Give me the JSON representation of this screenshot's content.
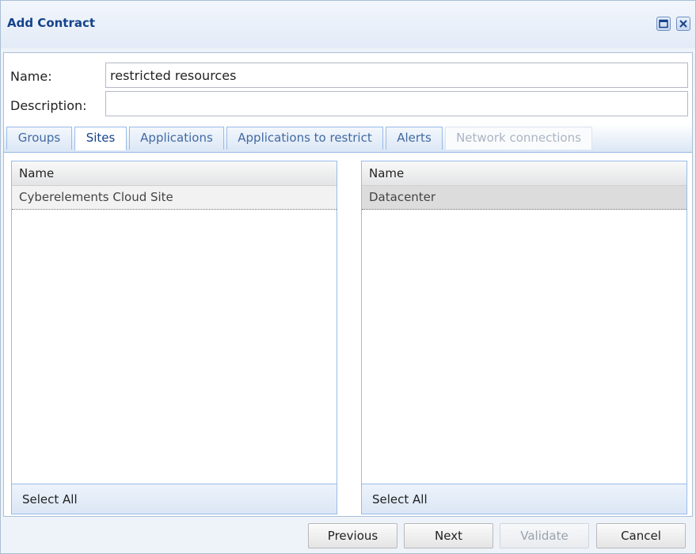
{
  "window": {
    "title": "Add Contract"
  },
  "form": {
    "name_label": "Name:",
    "name_value": "restricted resources",
    "description_label": "Description:",
    "description_value": ""
  },
  "tabs": [
    {
      "label": "Groups"
    },
    {
      "label": "Sites",
      "active": true
    },
    {
      "label": "Applications"
    },
    {
      "label": "Applications to restrict"
    },
    {
      "label": "Alerts"
    },
    {
      "label": "Network connections",
      "disabled": true
    }
  ],
  "left_grid": {
    "header": "Name",
    "rows": [
      "Cyberelements Cloud Site"
    ],
    "footer": "Select All"
  },
  "right_grid": {
    "header": "Name",
    "rows": [
      "Datacenter"
    ],
    "footer": "Select All"
  },
  "buttons": {
    "previous": "Previous",
    "next": "Next",
    "validate": "Validate",
    "cancel": "Cancel"
  }
}
